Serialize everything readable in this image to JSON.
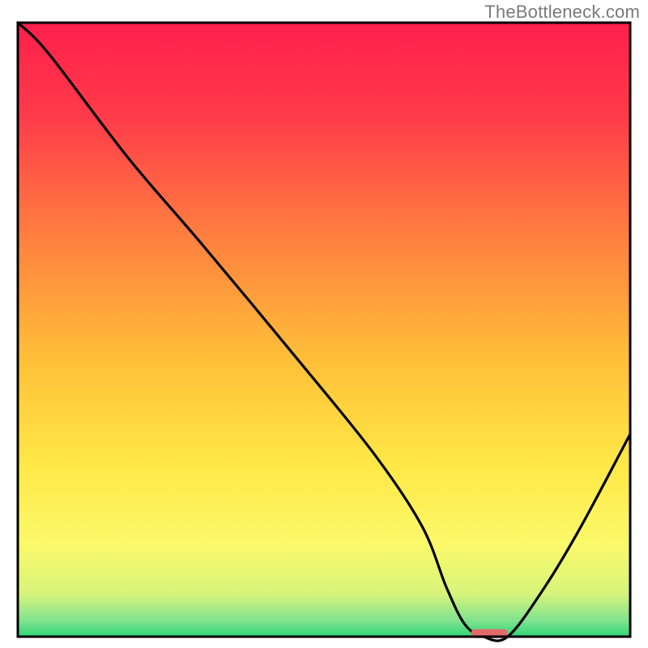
{
  "watermark": "TheBottleneck.com",
  "chart_data": {
    "type": "line",
    "title": "",
    "xlabel": "",
    "ylabel": "",
    "xlim": [
      0,
      100
    ],
    "ylim": [
      0,
      100
    ],
    "grid": false,
    "legend": false,
    "series": [
      {
        "name": "bottleneck-curve",
        "x": [
          0,
          5,
          18,
          30,
          45,
          58,
          66,
          70,
          73,
          76,
          80,
          86,
          92,
          100
        ],
        "y": [
          100,
          95,
          78,
          64,
          46,
          30,
          18,
          8,
          2,
          0,
          0,
          8,
          18,
          33
        ]
      }
    ],
    "marker": {
      "name": "optimal-range",
      "x_start": 74,
      "x_end": 80,
      "y": 0.5,
      "color": "#e26a6a"
    },
    "background_gradient": {
      "stops": [
        {
          "pos": 0.0,
          "color": "#ff1f4b"
        },
        {
          "pos": 0.15,
          "color": "#ff3a4a"
        },
        {
          "pos": 0.35,
          "color": "#ff803f"
        },
        {
          "pos": 0.55,
          "color": "#ffc038"
        },
        {
          "pos": 0.72,
          "color": "#ffe846"
        },
        {
          "pos": 0.85,
          "color": "#fbf96a"
        },
        {
          "pos": 0.93,
          "color": "#d7f47a"
        },
        {
          "pos": 0.975,
          "color": "#7de28f"
        },
        {
          "pos": 1.0,
          "color": "#2fd576"
        }
      ]
    }
  }
}
